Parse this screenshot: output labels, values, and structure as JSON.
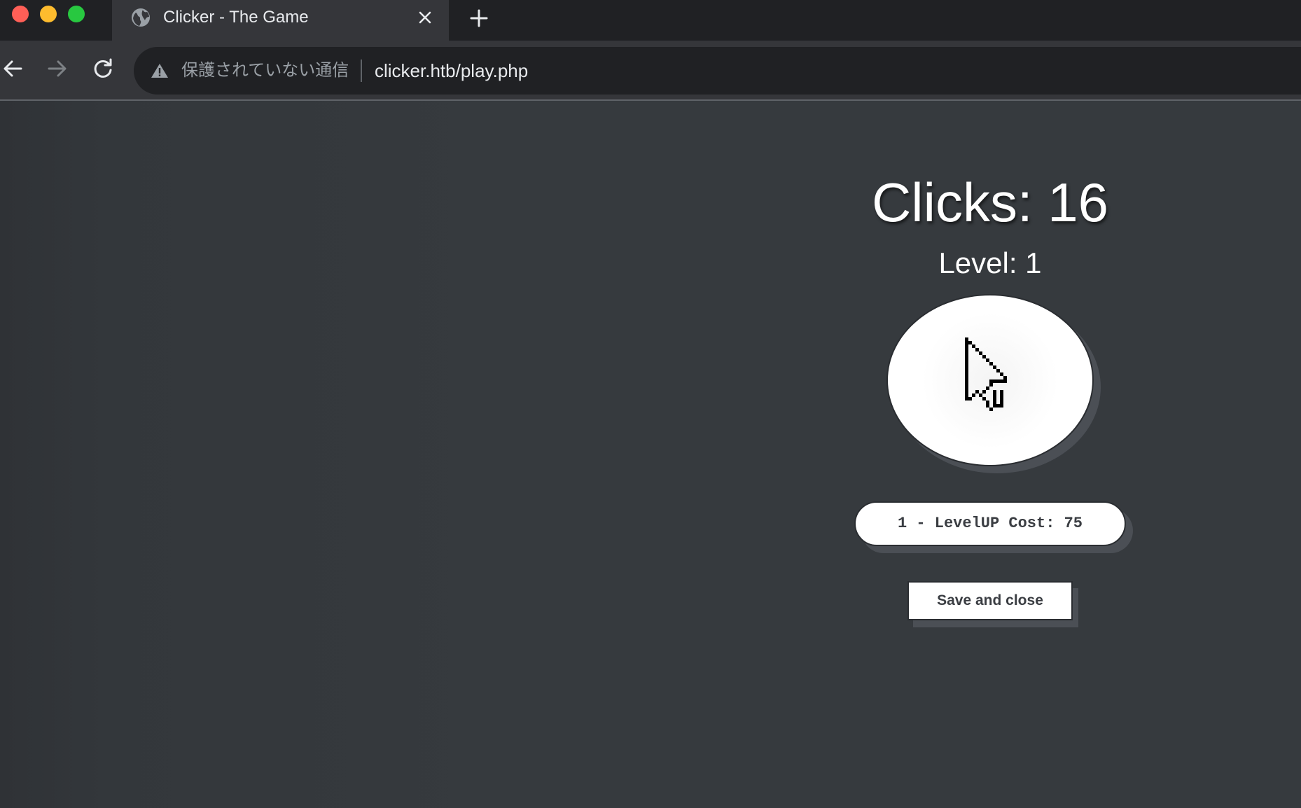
{
  "browser": {
    "tab": {
      "title": "Clicker - The Game",
      "favicon": "globe-icon"
    },
    "address_bar": {
      "security_label": "保護されていない通信",
      "url": "clicker.htb/play.php"
    },
    "icons": {
      "back": "arrow-left-icon",
      "forward": "arrow-right-icon",
      "reload": "reload-icon",
      "warning": "warning-icon",
      "close_tab": "close-icon",
      "new_tab": "plus-icon"
    }
  },
  "game": {
    "clicks_text": "Clicks: 16",
    "level_text": "Level: 1",
    "click_button_icon": "pointer-cursor-icon",
    "levelup_label": "1 - LevelUP Cost: 75",
    "save_label": "Save and close"
  },
  "colors": {
    "page_background": "#363a3e",
    "button_background": "#ffffff",
    "button_shadow": "#4b4f55",
    "traffic_close": "#ff5f57",
    "traffic_minimize": "#febc2e",
    "traffic_maximize": "#28c840"
  }
}
